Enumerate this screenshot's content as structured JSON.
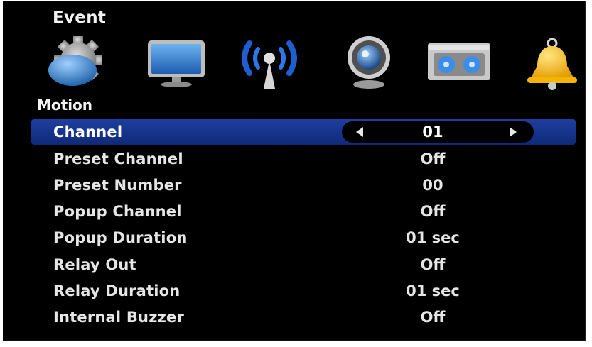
{
  "window": {
    "title": "Event"
  },
  "icons": [
    {
      "name": "gear-icon"
    },
    {
      "name": "monitor-icon"
    },
    {
      "name": "network-icon"
    },
    {
      "name": "camera-icon"
    },
    {
      "name": "recorder-icon"
    },
    {
      "name": "bell-icon"
    }
  ],
  "section": {
    "title": "Motion"
  },
  "rows": [
    {
      "label": "Channel",
      "value": "01",
      "selected": true
    },
    {
      "label": "Preset Channel",
      "value": "Off"
    },
    {
      "label": "Preset Number",
      "value": "00"
    },
    {
      "label": "Popup Channel",
      "value": "Off"
    },
    {
      "label": "Popup Duration",
      "value": "01 sec"
    },
    {
      "label": "Relay Out",
      "value": "Off"
    },
    {
      "label": "Relay Duration",
      "value": "01 sec"
    },
    {
      "label": "Internal Buzzer",
      "value": "Off"
    }
  ],
  "colors": {
    "highlight": "#1e3fa0",
    "background": "#000000",
    "text": "#e6e6e6"
  }
}
